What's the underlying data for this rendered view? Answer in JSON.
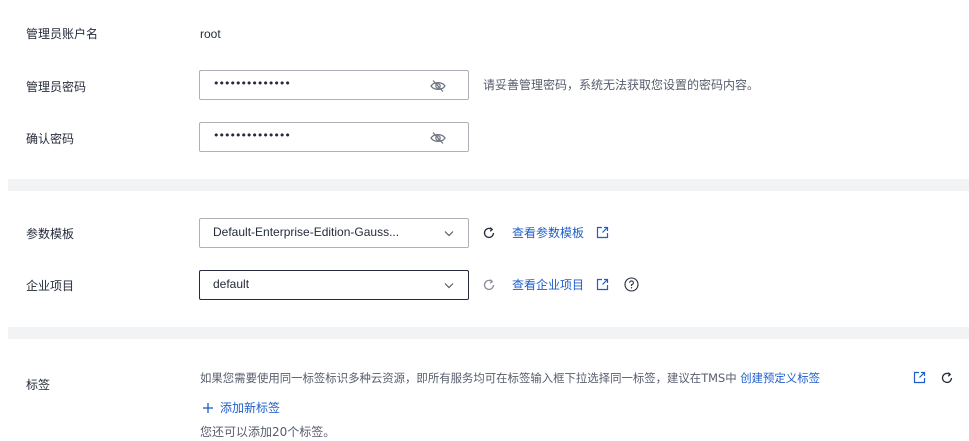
{
  "account": {
    "username_label": "管理员账户名",
    "username_value": "root"
  },
  "password": {
    "label": "管理员密码",
    "masked_value": "••••••••••••••",
    "hint": "请妥善管理密码，系统无法获取您设置的密码内容。"
  },
  "confirm_password": {
    "label": "确认密码",
    "masked_value": "••••••••••••••"
  },
  "param_template": {
    "label": "参数模板",
    "selected": "Default-Enterprise-Edition-Gauss...",
    "view_link": "查看参数模板"
  },
  "enterprise_project": {
    "label": "企业项目",
    "selected": "default",
    "view_link": "查看企业项目"
  },
  "tags": {
    "label": "标签",
    "description": "如果您需要使用同一标签标识多种云资源，即所有服务均可在标签输入框下拉选择同一标签，建议在TMS中",
    "create_link": "创建预定义标签",
    "add_label": "添加新标签",
    "remaining": "您还可以添加20个标签。"
  },
  "colors": {
    "link": "#1f5ec9",
    "band": "#f2f3f5",
    "border": "#adb0b8"
  }
}
